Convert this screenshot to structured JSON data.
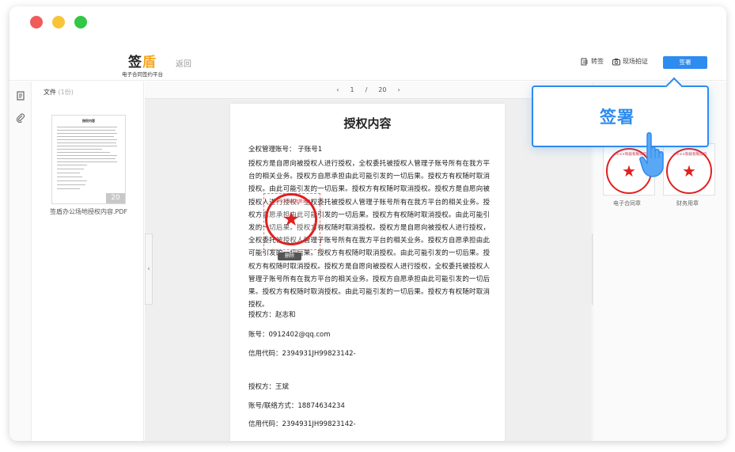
{
  "window": {
    "traffic_lights": [
      "close",
      "minimize",
      "maximize"
    ]
  },
  "header": {
    "logo_main_1": "签",
    "logo_main_2": "盾",
    "logo_sub": "电子合同签约平台",
    "back_label": "返回",
    "transfer_label": "转签",
    "evidence_label": "现场拍证",
    "sign_label": "签署",
    "icons": [
      "transfer-icon",
      "camera-icon"
    ]
  },
  "leftbar": {
    "icons": [
      "document-icon",
      "attachment-icon"
    ]
  },
  "files": {
    "title": "文件",
    "count": "(1份)",
    "thumb_title": "授权内容",
    "thumb_page": "20",
    "name": "签盾办公场地授权内容.PDF"
  },
  "pager": {
    "prev": "‹",
    "current": "1",
    "sep": "/",
    "total": "20",
    "next": "›"
  },
  "document": {
    "title": "授权内容",
    "account_line": "全权管理账号：  子账号1",
    "paragraph": "授权方是自愿向被授权人进行授权，全权委托被授权人管理子账号所有在我方平台的相关业务。授权方自愿承担由此可能引发的一切后果。授权方有权随时取消授权。由此可能引发的一切后果。授权方有权随时取消授权。授权方是自愿向被授权人进行授权，全权委托被授权人管理子账号所有在我方平台的相关业务。授权方自愿承担由此可能引发的一切后果。授权方有权随时取消授权。由此可能引发的一切后果。授权方有权随时取消授权。授权方是自愿向被授权人进行授权，全权委托被授权人管理子账号所有在我方平台的相关业务。授权方自愿承担由此可能引发的一切后果。授权方有权随时取消授权。由此可能引发的一切后果。授权方有权随时取消授权。授权方是自愿向被授权人进行授权，全权委托被授权人管理子账号所有在我方平台的相关业务。授权方自愿承担由此可能引发的一切后果。授权方有权随时取消授权。由此可能引发的一切后果。授权方有权随时取消授权。",
    "party1_label": "授权方：赵志和",
    "party1_account": "账号：0912402@qq.com",
    "party1_code": "信用代码：2394931JH99823142-",
    "party2_label": "授权方：王斌",
    "party2_contact": "账号/联络方式：18874634234",
    "party2_code": "信用代码：2394931JH99823142-",
    "stamp_delete": "删除",
    "stamp_text": "××××科技有限公司"
  },
  "rightpanel": {
    "seal1_label": "电子合同章",
    "seal2_label": "财务用章",
    "seal_text": "××××科技有限公司"
  },
  "popover": {
    "label": "签署"
  },
  "colors": {
    "accent": "#2e8bf0",
    "seal_red": "#e02020",
    "logo_accent": "#f5a623"
  }
}
